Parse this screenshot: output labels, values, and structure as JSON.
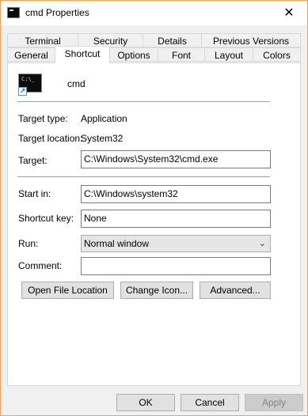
{
  "window": {
    "title": "cmd Properties",
    "close_symbol": "✕"
  },
  "tabs_row1": [
    "Terminal",
    "Security",
    "Details",
    "Previous Versions"
  ],
  "tabs_row2": [
    "General",
    "Shortcut",
    "Options",
    "Font",
    "Layout",
    "Colors"
  ],
  "active_tab": "Shortcut",
  "header": {
    "icon_prompt": "C:\\_",
    "name": "cmd"
  },
  "info": {
    "target_type_label": "Target type:",
    "target_type_value": "Application",
    "target_location_label": "Target location:",
    "target_location_value": "System32",
    "target_label": "Target:",
    "target_value": "C:\\Windows\\System32\\cmd.exe"
  },
  "fields": {
    "start_in_label": "Start in:",
    "start_in_value": "C:\\Windows\\system32",
    "shortcut_key_label": "Shortcut key:",
    "shortcut_key_value": "None",
    "run_label": "Run:",
    "run_value": "Normal window",
    "comment_label": "Comment:",
    "comment_value": ""
  },
  "actions": {
    "open_file_location": "Open File Location",
    "change_icon": "Change Icon...",
    "advanced": "Advanced..."
  },
  "footer": {
    "ok": "OK",
    "cancel": "Cancel",
    "apply": "Apply"
  }
}
